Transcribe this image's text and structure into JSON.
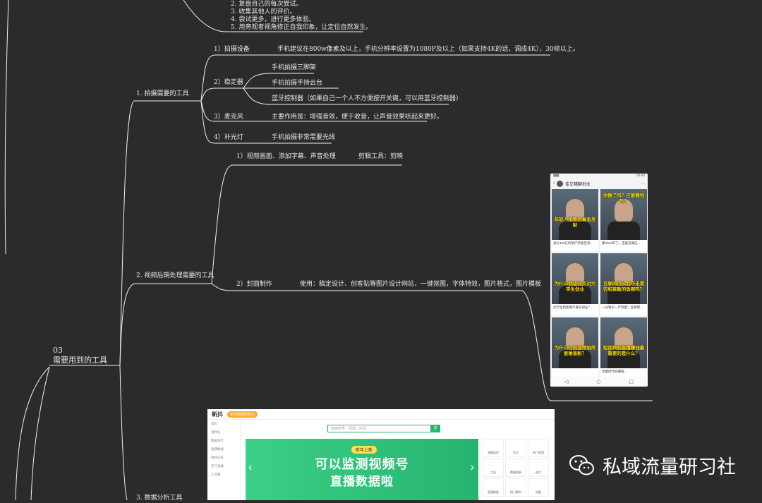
{
  "top_list": [
    "2. 复盘自己的每次尝试。",
    "3. 收集其他人的评价。",
    "4. 尝试更多，进行更多体验。",
    "5. 用旁观者视角修正自我印象，让定位自然发生。"
  ],
  "section": {
    "num": "03",
    "title": "需要用到的工具"
  },
  "branches": {
    "b1": "1. 拍摄需要的工具",
    "b2": "2. 视频后期处理需要的工具",
    "b3": "3. 数据分析工具"
  },
  "b1_items": {
    "i1": "1）拍摄设备",
    "i1_detail": "手机建议在800w像素及以上，手机分辨率设置为1080P及以上（如果支持4K的话，调成4K），30帧以上。",
    "i2": "2）稳定器",
    "i2_d1": "手机拍摄三脚架",
    "i2_d2": "手机拍摄手持云台",
    "i2_d3": "蓝牙控制器（如果自己一个人不方便按开关键，可以用蓝牙控制器）",
    "i3": "3）麦克风",
    "i3_detail": "主要作用是：增强音效，便于收音，让声音效果听起来更好。",
    "i4": "4）补光灯",
    "i4_detail": "手机拍摄非常需要光线"
  },
  "b2_items": {
    "i1": "1）视频画面、添加字幕、声音处理",
    "i1_detail": "剪辑工具：剪映",
    "i2": "2）封面制作",
    "i2_detail": "使用：稿定设计、创客贴等图片设计网站，一键抠图，字体特效，图片格式，图片模板"
  },
  "phone": {
    "status_time": "19:43",
    "account": "佳立猪聊创业",
    "captions": [
      "年轻人不要太着急发财",
      "你做了吗？还能赚钱吗？",
      "为什么我坚决反对大学生创业",
      "互联网巨头会夺走菜农和菜贩的饭碗吗？",
      "为什么你的视频始终很难涨粉？",
      "短视频和直播赚钱最重要的是什么？"
    ],
    "titles": [
      "身价100亿的地产老板告诉...",
      "那2021年了，还能去做这...",
      "大学生到底要不要去创业？...",
      "一分钱买一斤鸡蛋！互联网...",
      "",
      "流量时代的赚钱..."
    ]
  },
  "web": {
    "logo": "新抖",
    "pill": "新抖旗舰版发布",
    "search_placeholder": "搜索账号、视频、商品",
    "badge": "新年上新",
    "line1": "可以监测视频号",
    "line2": "直播数据啦",
    "side": [
      "首页",
      "视频号",
      "数据排行",
      "直播数据",
      "视频分析",
      "热门视频",
      "工具箱"
    ],
    "tiles": [
      "直播监控",
      "号主",
      "热门视频",
      "工具",
      "数据榜单",
      "热点",
      "直播数据",
      "热门素材",
      "选题"
    ]
  },
  "watermark": "私域流量研习社"
}
